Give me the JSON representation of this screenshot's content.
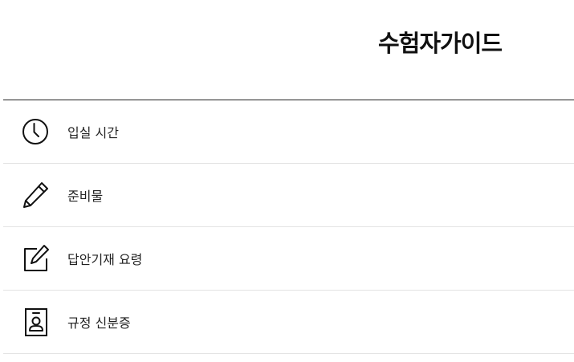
{
  "header": {
    "title": "수험자가이드"
  },
  "menu": {
    "items": [
      {
        "label": "입실 시간",
        "icon": "clock-icon"
      },
      {
        "label": "준비물",
        "icon": "pencil-icon"
      },
      {
        "label": "답안기재 요령",
        "icon": "edit-icon"
      },
      {
        "label": "규정 신분증",
        "icon": "id-card-icon"
      }
    ]
  },
  "colors": {
    "text": "#111111",
    "divider": "#e3e3e3",
    "top_rule": "#222222",
    "background": "#ffffff"
  }
}
